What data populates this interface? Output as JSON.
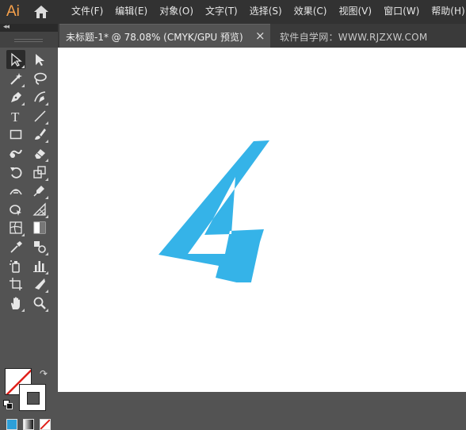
{
  "app": {
    "logo_text": "Ai"
  },
  "menu": [
    "文件(F)",
    "编辑(E)",
    "对象(O)",
    "文字(T)",
    "选择(S)",
    "效果(C)",
    "视图(V)",
    "窗口(W)",
    "帮助(H)"
  ],
  "tabs": {
    "document_label": "未标题-1* @ 78.08% (CMYK/GPU 预览)",
    "close_glyph": "×",
    "watermark": "软件自学网：WWW.RJZXW.COM"
  },
  "toolbar": {
    "collapse_glyph": "◂◂",
    "tools": [
      "selection-tool-icon",
      "direct-selection-tool-icon",
      "magic-wand-tool-icon",
      "lasso-tool-icon",
      "pen-tool-icon",
      "curvature-tool-icon",
      "type-tool-icon",
      "line-segment-tool-icon",
      "rectangle-tool-icon",
      "paintbrush-tool-icon",
      "shaper-tool-icon",
      "eraser-tool-icon",
      "rotate-tool-icon",
      "scale-tool-icon",
      "width-tool-icon",
      "puppet-warp-tool-icon",
      "shape-builder-tool-icon",
      "perspective-grid-tool-icon",
      "mesh-tool-icon",
      "gradient-tool-icon",
      "eyedropper-tool-icon",
      "blend-tool-icon",
      "symbol-sprayer-tool-icon",
      "column-graph-tool-icon",
      "artboard-tool-icon",
      "slice-tool-icon",
      "hand-tool-icon",
      "zoom-tool-icon"
    ],
    "swap_glyph": "↷"
  },
  "colors": {
    "artwork_fill": "#35b3e8",
    "app_logo": "#f7a14b",
    "canvas": "#ffffff",
    "panel": "#535353",
    "menubar": "#323232"
  },
  "artwork": {
    "glyph": "4"
  }
}
